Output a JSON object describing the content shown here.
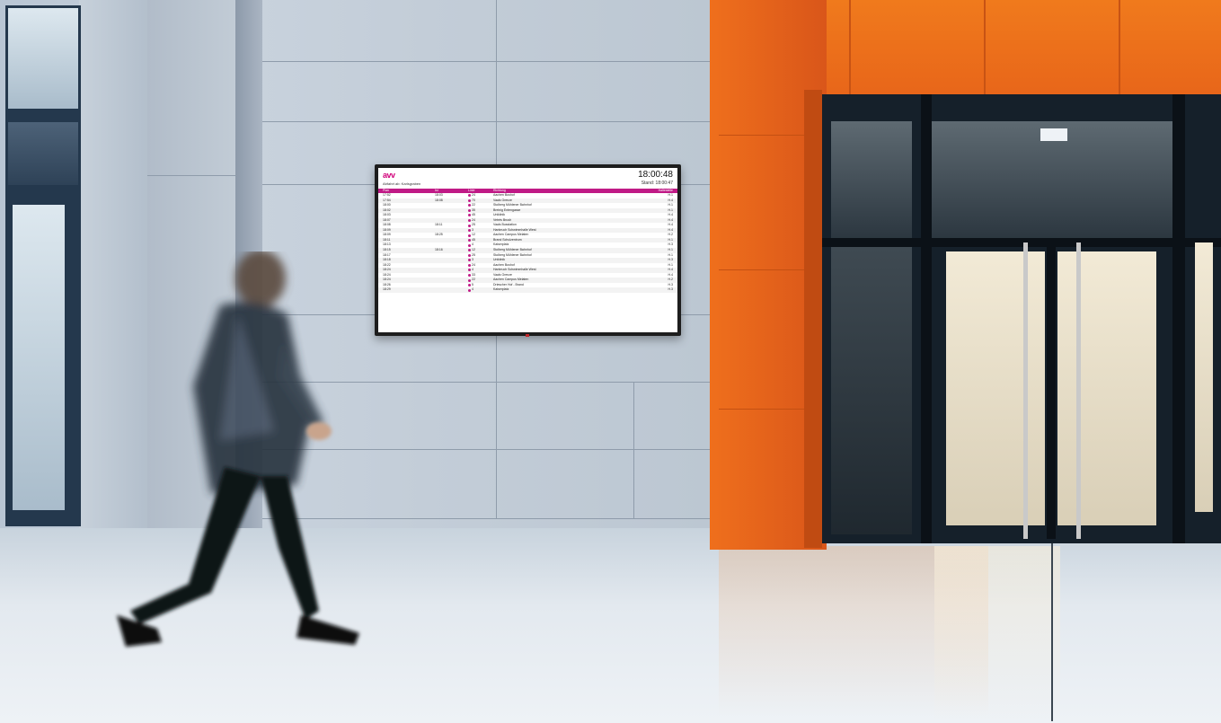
{
  "display": {
    "logo": "avv",
    "clock": "18:00:48",
    "stop_label": "Abfahrt ab: Karlsgraben",
    "updated_label": "Stand: 18:00:47",
    "columns": [
      "Plan",
      "Ist",
      "Linie",
      "Richtung",
      "Haltestelle"
    ],
    "departures": [
      {
        "plan": "17:52",
        "ist": "18:03",
        "line": "24",
        "direction": "Aachen Bushof",
        "stop": "H.1"
      },
      {
        "plan": "17:54",
        "ist": "18:08",
        "line": "70",
        "direction": "Vaals Grenze",
        "stop": "H.4"
      },
      {
        "plan": "18:00",
        "ist": "",
        "line": "22",
        "direction": "Stolberg Mühlener Bahnhof",
        "stop": "H.1"
      },
      {
        "plan": "18:02",
        "ist": "",
        "line": "35",
        "direction": "Breinig Entengasse",
        "stop": "H.1"
      },
      {
        "plan": "18:03",
        "ist": "",
        "line": "45",
        "direction": "Uniklinik",
        "stop": "H.4"
      },
      {
        "plan": "18:07",
        "ist": "",
        "line": "24",
        "direction": "Vetrès Brush",
        "stop": "H.4"
      },
      {
        "plan": "18:08",
        "ist": "18:11",
        "line": "25",
        "direction": "Vaals Busstation",
        "stop": "H.4"
      },
      {
        "plan": "18:09",
        "ist": "",
        "line": "3",
        "direction": "Hanbruch Schwimmhalle West",
        "stop": "H.4"
      },
      {
        "plan": "18:09",
        "ist": "18:25",
        "line": "12",
        "direction": "Aachen Campus Melaten",
        "stop": "H.2"
      },
      {
        "plan": "18:11",
        "ist": "",
        "line": "45",
        "direction": "Brand Schulzentrum",
        "stop": "H.1"
      },
      {
        "plan": "18:13",
        "ist": "",
        "line": "4",
        "direction": "Kaiserplatz",
        "stop": "H.3"
      },
      {
        "plan": "18:15",
        "ist": "18:16",
        "line": "12",
        "direction": "Stolberg Mühlener Bahnhof",
        "stop": "H.1"
      },
      {
        "plan": "18:17",
        "ist": "",
        "line": "25",
        "direction": "Stolberg Mühlener Bahnhof",
        "stop": "H.1"
      },
      {
        "plan": "18:18",
        "ist": "",
        "line": "3",
        "direction": "Uniklinik",
        "stop": "H.3"
      },
      {
        "plan": "18:22",
        "ist": "",
        "line": "24",
        "direction": "Aachen Bushof",
        "stop": "H.1"
      },
      {
        "plan": "18:24",
        "ist": "",
        "line": "4",
        "direction": "Hanbruch Schwimmhalle West",
        "stop": "H.4"
      },
      {
        "plan": "18:24",
        "ist": "",
        "line": "33",
        "direction": "Vaals Grenze",
        "stop": "H.4"
      },
      {
        "plan": "18:24",
        "ist": "",
        "line": "22",
        "direction": "Aachen Campus Melaten",
        "stop": "H.2"
      },
      {
        "plan": "18:26",
        "ist": "",
        "line": "5",
        "direction": "Driescher Hof - Brand",
        "stop": "H.3"
      },
      {
        "plan": "18:29",
        "ist": "",
        "line": "4",
        "direction": "Kaiserplatz",
        "stop": "H.3"
      }
    ]
  },
  "colors": {
    "accent": "#c01a86",
    "orange": "#ef6f1c"
  }
}
